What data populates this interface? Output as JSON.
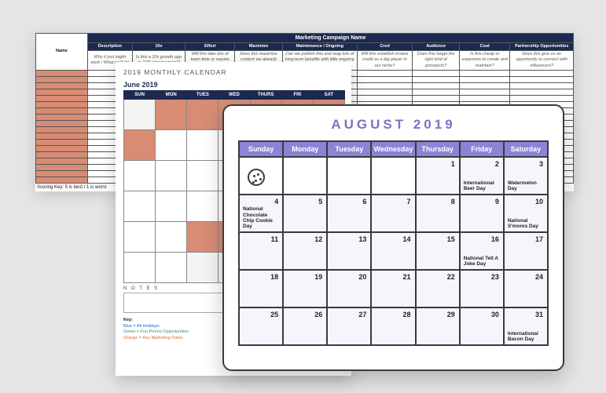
{
  "sheet": {
    "title": "Marketing Campaign Name",
    "name_label": "Name",
    "cols": [
      {
        "hdr": "Description",
        "sub": "Why it just might work / What we'll do"
      },
      {
        "hdr": "10x",
        "sub": "Is this a 10x growth opp or 10% improvement?"
      },
      {
        "hdr": "Effort",
        "sub": "Will this take lots of team time or require outside help?"
      },
      {
        "hdr": "Maximize",
        "sub": "Does this maximize content we already have?"
      },
      {
        "hdr": "Maintenance / Ongoing",
        "sub": "Can we publish this and reap lots of long-term benefits with little ongoing effort?"
      },
      {
        "hdr": "Cred",
        "sub": "Will this establish insane credit as a big player in our niche?"
      },
      {
        "hdr": "Audience",
        "sub": "Does this target the right kind of prospects?"
      },
      {
        "hdr": "Cost",
        "sub": "Is this cheap or expensive to create and maintain?"
      },
      {
        "hdr": "Partnership Opportunities",
        "sub": "Does this give us an opportunity to connect with influencers?"
      }
    ],
    "key": "Scoring Key: 5 is best / 1 is worst"
  },
  "monthly": {
    "title": "2019 MONTHLY CALENDAR",
    "month": "June 2019",
    "days": [
      "SUN",
      "MON",
      "TUES",
      "WED",
      "THURS",
      "FRI",
      "SAT"
    ],
    "notes_label": "N O T E S",
    "key_heading": "Key:",
    "key_blue": "Blue = All Holidays",
    "key_green": "Green = Fun Promo Opportunities",
    "key_orange": "Orange = Key Marketing Dates"
  },
  "card": {
    "title": "AUGUST 2019",
    "days": [
      "Sunday",
      "Monday",
      "Tuesday",
      "Wednesday",
      "Thursday",
      "Friday",
      "Saturday"
    ],
    "weeks": [
      [
        {
          "blank": true,
          "cookie": true
        },
        {
          "blank": true
        },
        {
          "blank": true
        },
        {
          "blank": true
        },
        {
          "n": "1"
        },
        {
          "n": "2",
          "ev": "International Beer Day"
        },
        {
          "n": "3",
          "ev": "Watermelon Day"
        }
      ],
      [
        {
          "n": "4",
          "ev": "National Chocolate Chip Cookie Day"
        },
        {
          "n": "5"
        },
        {
          "n": "6"
        },
        {
          "n": "7"
        },
        {
          "n": "8"
        },
        {
          "n": "9"
        },
        {
          "n": "10",
          "ev": "National S'mores Day"
        }
      ],
      [
        {
          "n": "11"
        },
        {
          "n": "12"
        },
        {
          "n": "13"
        },
        {
          "n": "14"
        },
        {
          "n": "15"
        },
        {
          "n": "16",
          "ev": "National Tell A Joke Day"
        },
        {
          "n": "17"
        }
      ],
      [
        {
          "n": "18"
        },
        {
          "n": "19"
        },
        {
          "n": "20"
        },
        {
          "n": "21"
        },
        {
          "n": "22"
        },
        {
          "n": "23"
        },
        {
          "n": "24"
        }
      ],
      [
        {
          "n": "25"
        },
        {
          "n": "26"
        },
        {
          "n": "27"
        },
        {
          "n": "28"
        },
        {
          "n": "29"
        },
        {
          "n": "30"
        },
        {
          "n": "31",
          "ev": "International Bacon Day"
        }
      ]
    ]
  }
}
